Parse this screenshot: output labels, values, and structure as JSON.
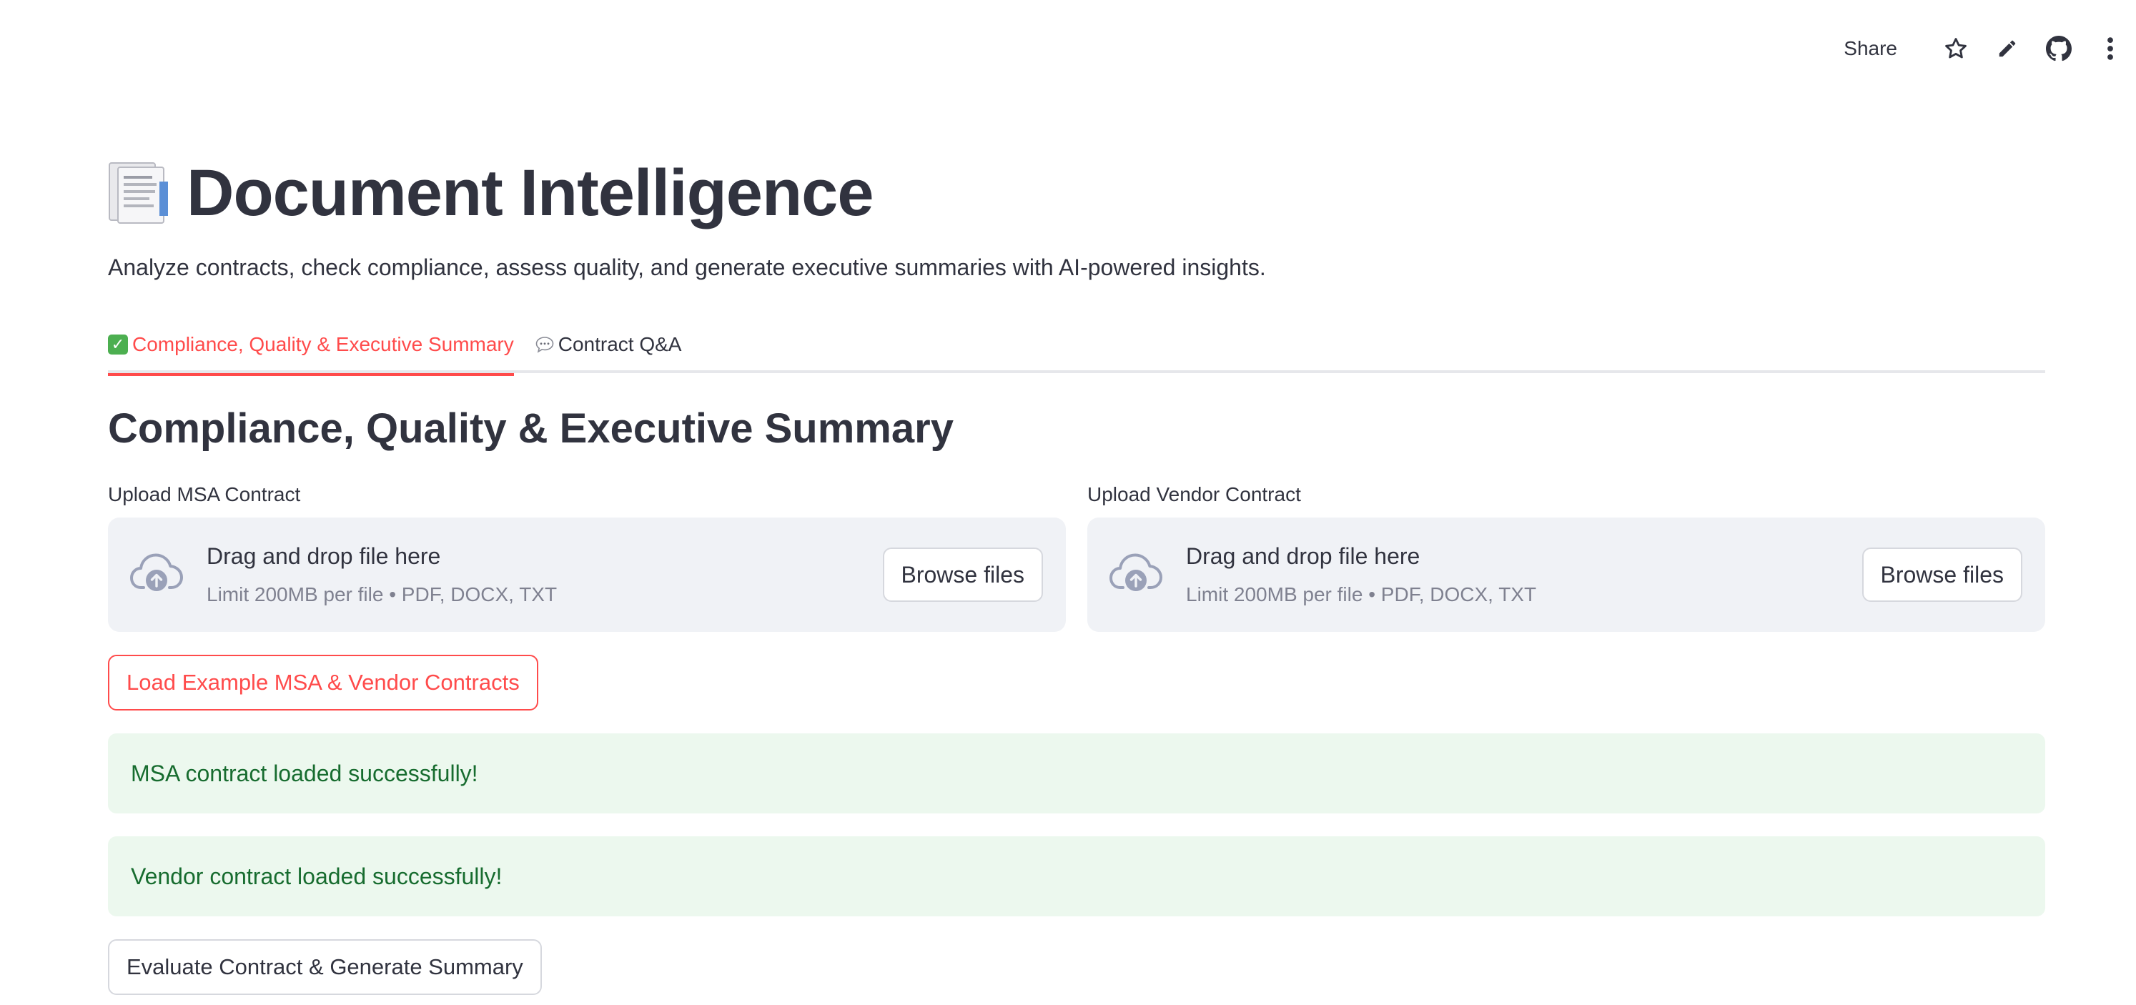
{
  "toolbar": {
    "share_label": "Share",
    "icons": [
      "star-icon",
      "pencil-icon",
      "github-icon",
      "kebab-menu-icon"
    ]
  },
  "header": {
    "title_icon": "document-icon",
    "title": "Document Intelligence",
    "subtitle": "Analyze contracts, check compliance, assess quality, and generate executive summaries with AI-powered insights."
  },
  "tabs": [
    {
      "icon": "check-icon",
      "label": "Compliance, Quality & Executive Summary",
      "active": true
    },
    {
      "icon": "speech-bubble-icon",
      "label": "Contract Q&A",
      "active": false
    }
  ],
  "section": {
    "title": "Compliance, Quality & Executive Summary"
  },
  "uploaders": [
    {
      "label": "Upload MSA Contract",
      "drop_text": "Drag and drop file here",
      "hint": "Limit 200MB per file • PDF, DOCX, TXT",
      "button_label": "Browse files"
    },
    {
      "label": "Upload Vendor Contract",
      "drop_text": "Drag and drop file here",
      "hint": "Limit 200MB per file • PDF, DOCX, TXT",
      "button_label": "Browse files"
    }
  ],
  "actions": {
    "load_example_label": "Load Example MSA & Vendor Contracts",
    "evaluate_label": "Evaluate Contract & Generate Summary"
  },
  "alerts": {
    "msa_loaded": "MSA contract loaded successfully!",
    "vendor_loaded": "Vendor contract loaded successfully!"
  },
  "colors": {
    "accent": "#ff4b4b",
    "text": "#31333f",
    "dropzone_bg": "#f0f2f6",
    "success_bg": "#ecf8ee",
    "success_text": "#176c2f"
  }
}
